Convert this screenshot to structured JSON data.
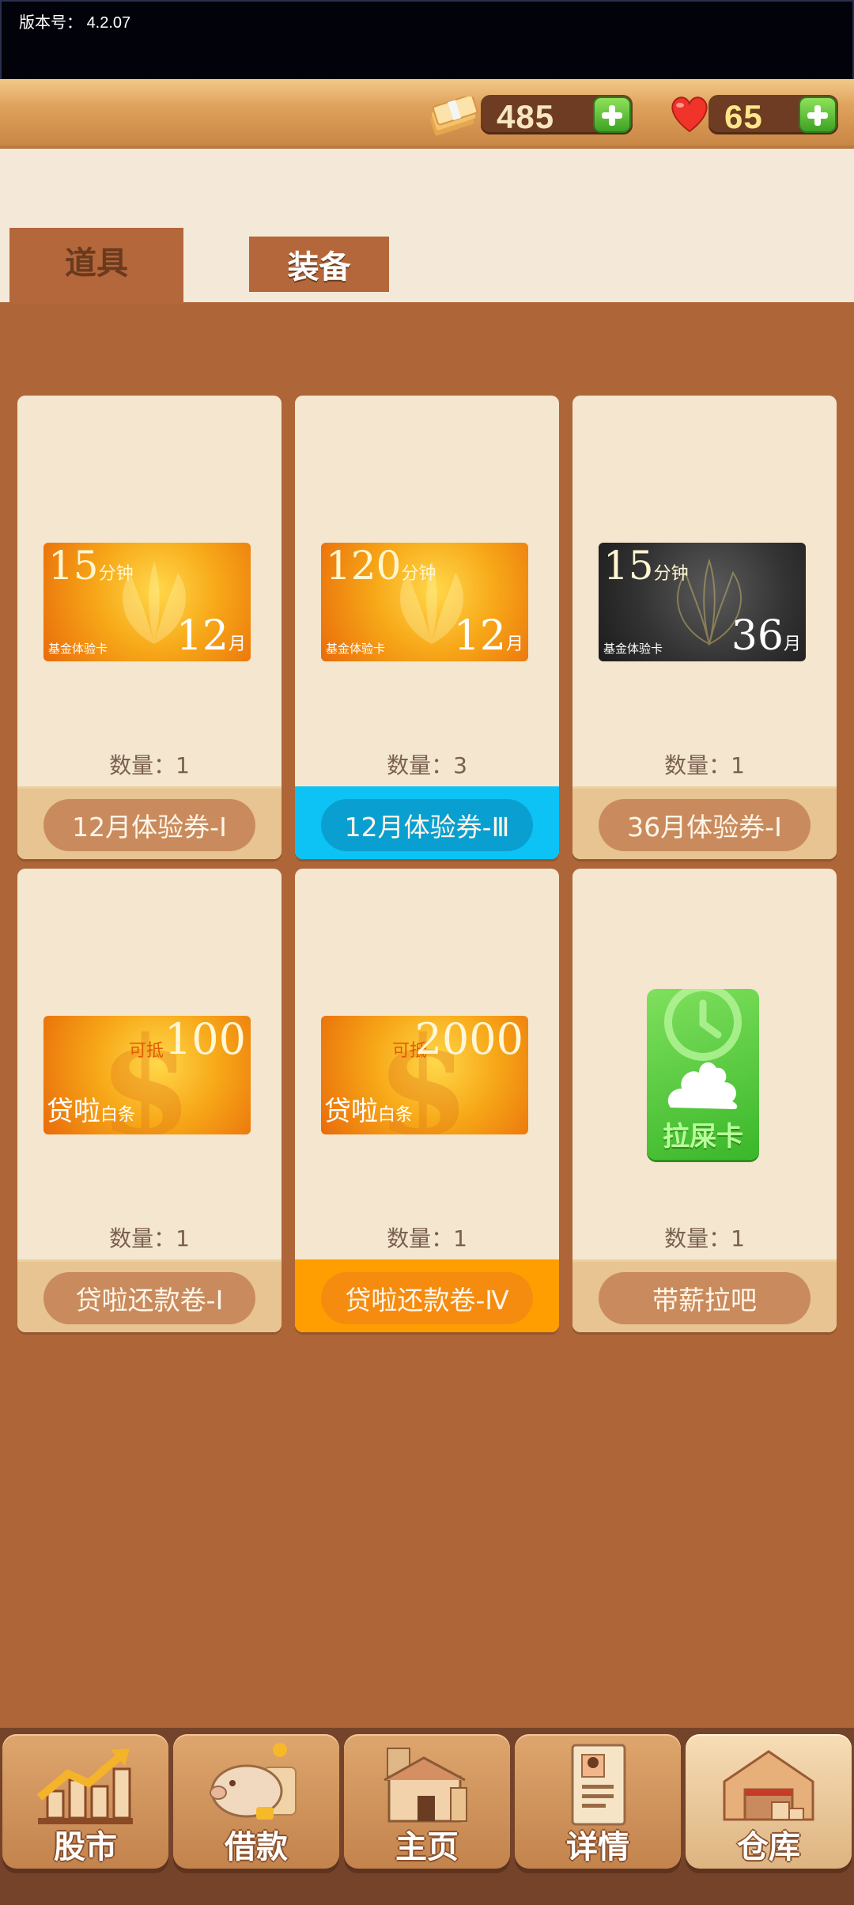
{
  "version": {
    "label": "版本号：",
    "value": "4.2.07"
  },
  "resources": {
    "money": "485",
    "hearts": "65"
  },
  "tabs": {
    "items": "道具",
    "equipment": "装备"
  },
  "inventory": [
    {
      "type": "fund",
      "style": "gold",
      "minutes": "15",
      "minute_unit": "分钟",
      "months": "12",
      "month_unit": "月",
      "card_tag": "基金体验卡",
      "qty": "数量：1",
      "name": "12月体验券-Ⅰ",
      "state": "normal"
    },
    {
      "type": "fund",
      "style": "gold",
      "minutes": "120",
      "minute_unit": "分钟",
      "months": "12",
      "month_unit": "月",
      "card_tag": "基金体验卡",
      "qty": "数量：3",
      "name": "12月体验券-Ⅲ",
      "state": "selected-blue"
    },
    {
      "type": "fund",
      "style": "dark",
      "minutes": "15",
      "minute_unit": "分钟",
      "months": "36",
      "month_unit": "月",
      "card_tag": "基金体验卡",
      "qty": "数量：1",
      "name": "36月体验券-Ⅰ",
      "state": "normal"
    },
    {
      "type": "loan",
      "deduct_label": "可抵",
      "amount": "100",
      "brand": "贷啦",
      "brand_sub": "白条",
      "qty": "数量：1",
      "name": "贷啦还款卷-Ⅰ",
      "state": "normal"
    },
    {
      "type": "loan",
      "deduct_label": "可抵",
      "amount": "2000",
      "brand": "贷啦",
      "brand_sub": "白条",
      "qty": "数量：1",
      "name": "贷啦还款卷-Ⅳ",
      "state": "selected-orange"
    },
    {
      "type": "poop",
      "card_label": "拉屎卡",
      "qty": "数量：1",
      "name": "带薪拉吧",
      "state": "normal"
    }
  ],
  "nav": [
    {
      "label": "股市",
      "icon": "stock-chart-icon"
    },
    {
      "label": "借款",
      "icon": "piggy-bank-icon"
    },
    {
      "label": "主页",
      "icon": "home-icon"
    },
    {
      "label": "详情",
      "icon": "profile-document-icon"
    },
    {
      "label": "仓库",
      "icon": "warehouse-icon",
      "active": true
    }
  ],
  "colors": {
    "background": "#ae6537",
    "selected_blue": "#0dc2f5",
    "selected_orange": "#ff9e00"
  }
}
